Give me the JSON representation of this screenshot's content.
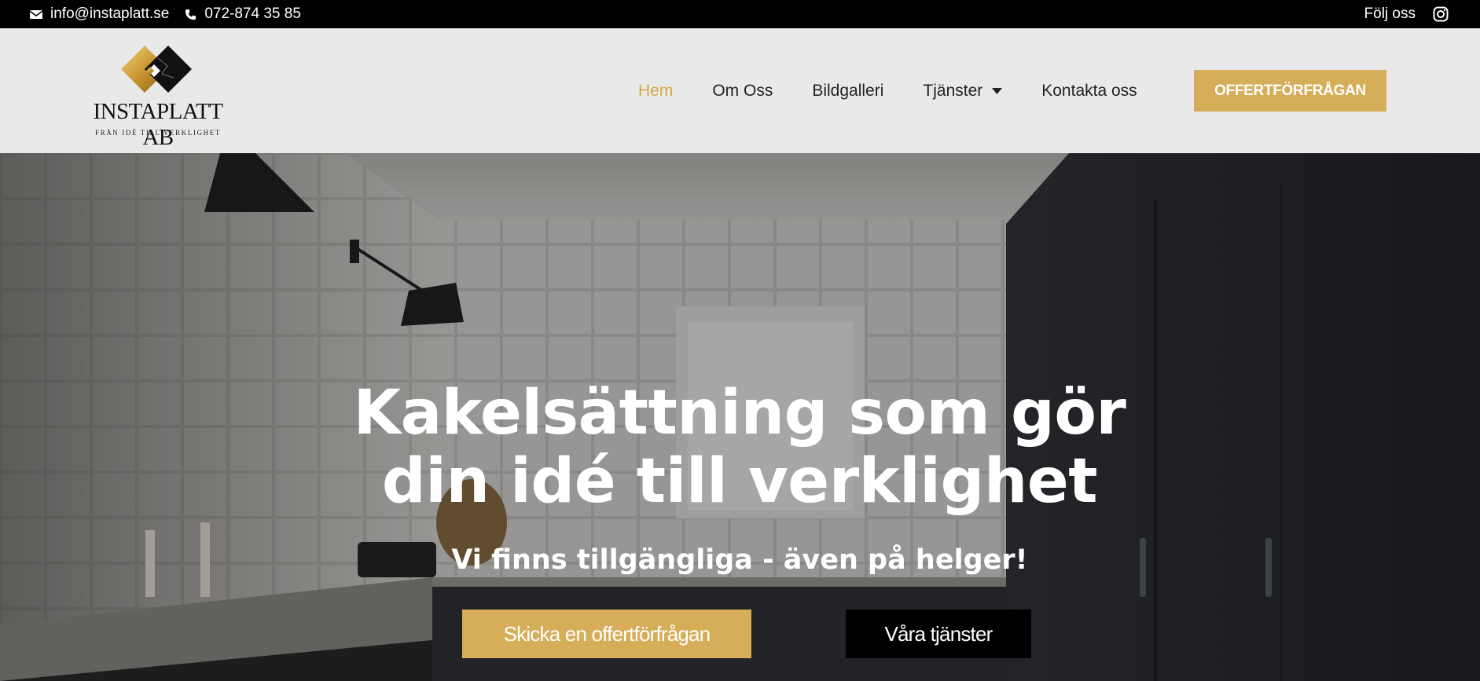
{
  "topbar": {
    "email": "info@instaplatt.se",
    "phone": "072-874 35 85",
    "follow_label": "Följ oss",
    "icons": [
      "envelope-icon",
      "phone-icon",
      "instagram-icon"
    ]
  },
  "header": {
    "logo": {
      "name": "INSTAPLATT AB",
      "tagline": "FRÅN IDÉ TILL VERKLIGHET"
    },
    "nav": [
      {
        "label": "Hem",
        "active": true
      },
      {
        "label": "Om Oss",
        "active": false
      },
      {
        "label": "Bildgalleri",
        "active": false
      },
      {
        "label": "Tjänster",
        "active": false,
        "has_dropdown": true
      },
      {
        "label": "Kontakta oss",
        "active": false
      }
    ],
    "cta_label": "OFFERTFÖRFRÅGAN"
  },
  "hero": {
    "title_line1": "Kakelsättning som gör",
    "title_line2": "din idé till verklighet",
    "subtitle": "Vi finns tillgängliga - även på helger!",
    "primary_button": "Skicka en offertförfrågan",
    "secondary_button": "Våra tjänster"
  },
  "colors": {
    "accent": "#d6ad58",
    "active_nav": "#d4a944",
    "topbar": "#000000",
    "header_bg": "#e9e9e9"
  }
}
